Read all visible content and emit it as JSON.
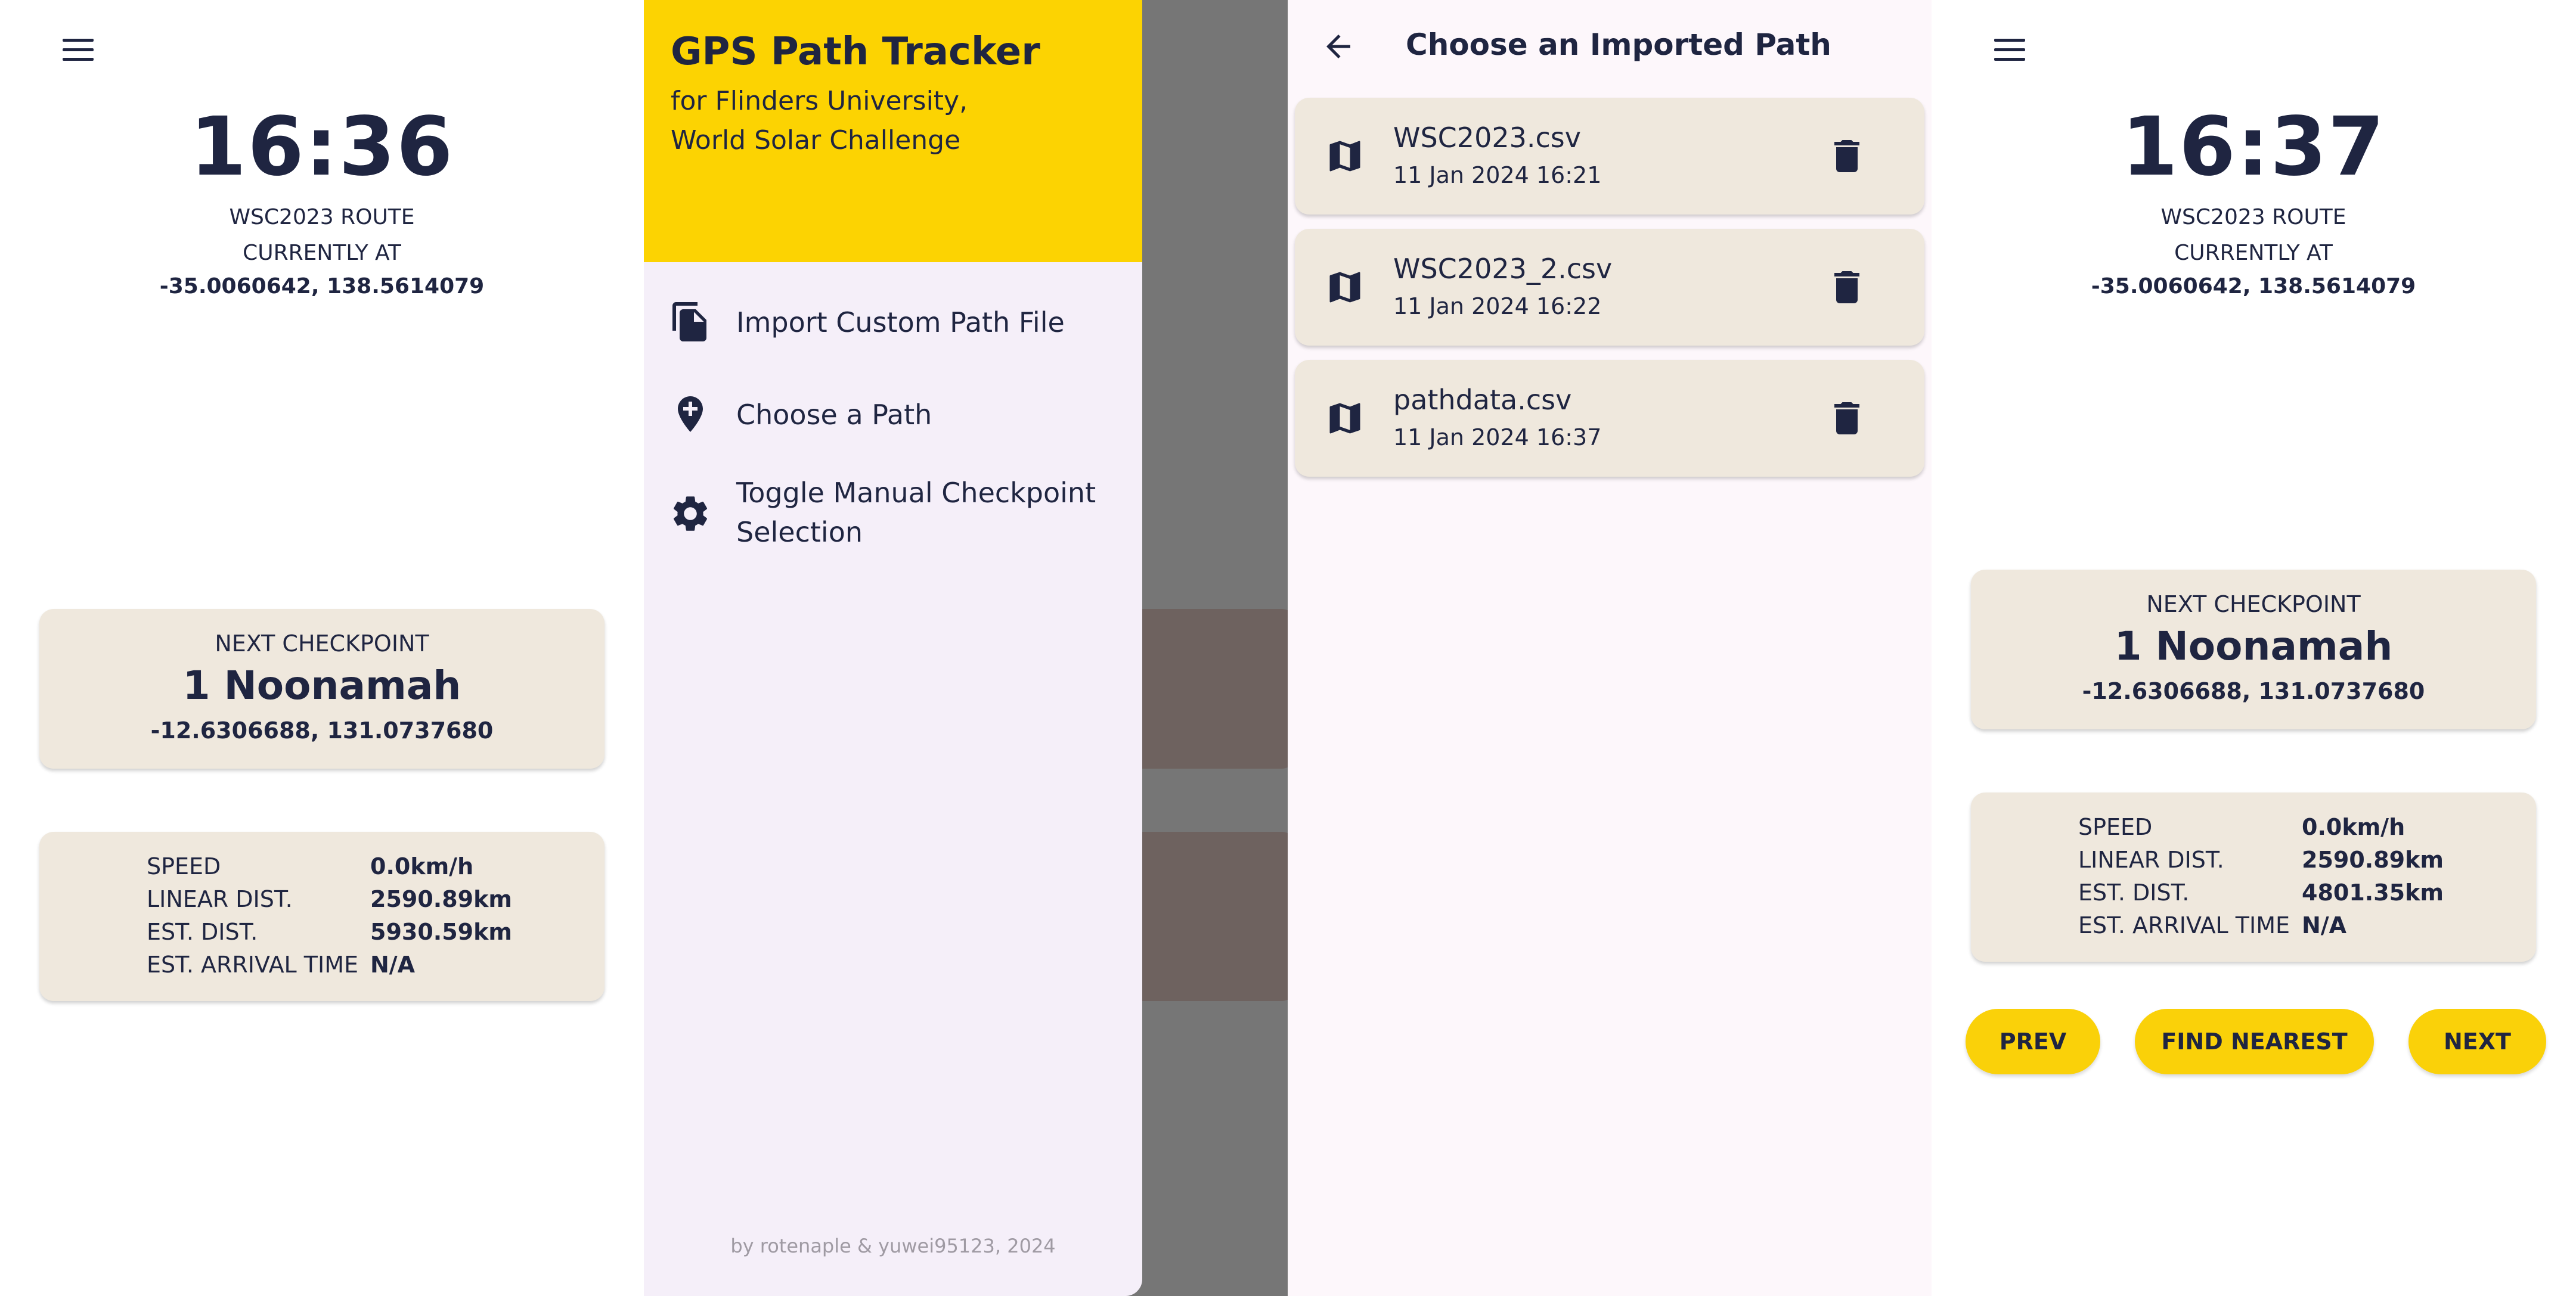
{
  "screen1": {
    "time": "16:36",
    "route_name": "WSC2023 ROUTE",
    "currently_at_label": "CURRENTLY AT",
    "current_coords": "-35.0060642, 138.5614079",
    "next_checkpoint_label": "NEXT CHECKPOINT",
    "next_checkpoint_name": "1 Noonamah",
    "next_checkpoint_coords": "-12.6306688, 131.0737680",
    "stats": [
      {
        "label": "SPEED",
        "value": "0.0km/h"
      },
      {
        "label": "LINEAR DIST.",
        "value": "2590.89km"
      },
      {
        "label": "EST. DIST.",
        "value": "5930.59km"
      },
      {
        "label": "EST. ARRIVAL TIME",
        "value": "N/A"
      }
    ]
  },
  "drawer": {
    "title": "GPS Path Tracker",
    "subtitle_line1": "for Flinders University,",
    "subtitle_line2": "World Solar Challenge",
    "items": [
      {
        "label": "Import Custom Path File",
        "icon": "file-copy-icon"
      },
      {
        "label": "Choose a Path",
        "icon": "add-location-icon"
      },
      {
        "label": "Toggle Manual Checkpoint Selection",
        "icon": "gear-icon"
      }
    ],
    "footer": "by rotenaple & yuwei95123, 2024"
  },
  "screen3": {
    "title": "Choose an Imported Path",
    "files": [
      {
        "name": "WSC2023.csv",
        "date": "11 Jan 2024 16:21"
      },
      {
        "name": "WSC2023_2.csv",
        "date": "11 Jan 2024 16:22"
      },
      {
        "name": "pathdata.csv",
        "date": "11 Jan 2024 16:37"
      }
    ]
  },
  "screen4": {
    "time": "16:37",
    "route_name": "WSC2023 ROUTE",
    "currently_at_label": "CURRENTLY AT",
    "current_coords": "-35.0060642, 138.5614079",
    "next_checkpoint_label": "NEXT CHECKPOINT",
    "next_checkpoint_name": "1 Noonamah",
    "next_checkpoint_coords": "-12.6306688, 131.0737680",
    "stats": [
      {
        "label": "SPEED",
        "value": "0.0km/h"
      },
      {
        "label": "LINEAR DIST.",
        "value": "2590.89km"
      },
      {
        "label": "EST. DIST.",
        "value": "4801.35km"
      },
      {
        "label": "EST. ARRIVAL TIME",
        "value": "N/A"
      }
    ],
    "buttons": {
      "prev": "PREV",
      "find_nearest": "FIND NEAREST",
      "next": "NEXT"
    }
  },
  "colors": {
    "accent_yellow": "#fcd302",
    "card_bg": "#efe8dd",
    "text_navy": "#1f2541",
    "drawer_bg": "#f5eff9",
    "scrim": "#767676"
  }
}
